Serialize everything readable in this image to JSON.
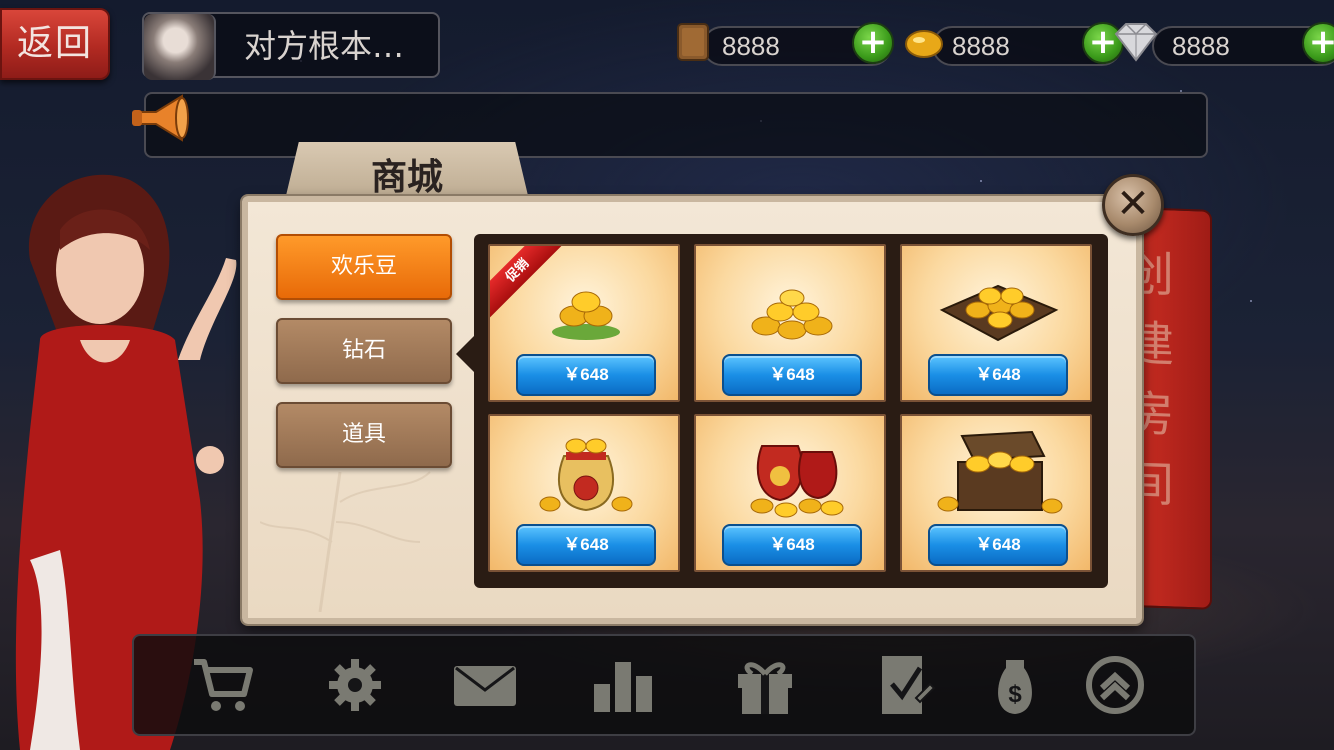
{
  "header": {
    "back_label": "返回",
    "nickname": "对方根本…"
  },
  "resources": [
    {
      "icon": "ticket-icon",
      "value": "8888"
    },
    {
      "icon": "gold-bean-icon",
      "value": "8888"
    },
    {
      "icon": "diamond-icon",
      "value": "8888"
    }
  ],
  "plus_label": "+",
  "shop": {
    "title": "商城",
    "close_label": "✕",
    "categories": [
      {
        "label": "欢乐豆",
        "active": true
      },
      {
        "label": "钻石",
        "active": false
      },
      {
        "label": "道具",
        "active": false
      }
    ],
    "promo_label": "促销",
    "items": [
      {
        "art": "bean-small-pile-icon",
        "price": "￥648"
      },
      {
        "art": "bean-scatter-icon",
        "price": "￥648"
      },
      {
        "art": "bean-tray-icon",
        "price": "￥648"
      },
      {
        "art": "bean-sack-icon",
        "price": "￥648"
      },
      {
        "art": "bean-double-sack-icon",
        "price": "￥648"
      },
      {
        "art": "bean-chest-icon",
        "price": "￥648"
      }
    ]
  },
  "book_text": "创建房间",
  "bottom_nav": [
    {
      "icon": "cart-icon"
    },
    {
      "icon": "gear-icon"
    },
    {
      "icon": "mail-icon"
    },
    {
      "icon": "ranking-icon"
    },
    {
      "icon": "gift-icon"
    },
    {
      "icon": "task-icon"
    },
    {
      "icon": "money-bag-icon"
    },
    {
      "icon": "upgrade-icon"
    }
  ],
  "colors": {
    "accent_orange": "#e86a08",
    "buy_blue": "#1a8fe6",
    "back_red": "#b22a22",
    "plus_green": "#3a9a1a"
  }
}
